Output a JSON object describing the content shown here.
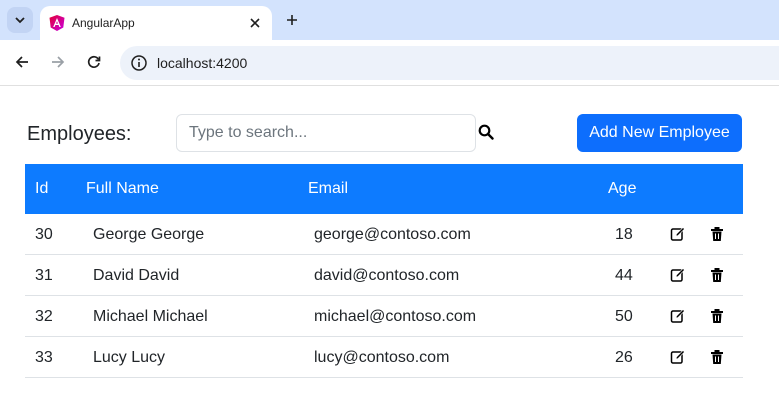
{
  "browser": {
    "tab_title": "AngularApp",
    "url": "localhost:4200"
  },
  "page": {
    "title": "Employees:",
    "search_placeholder": "Type to search...",
    "add_button_label": "Add New Employee"
  },
  "table": {
    "headers": {
      "id": "Id",
      "full_name": "Full Name",
      "email": "Email",
      "age": "Age"
    },
    "rows": [
      {
        "id": "30",
        "full_name": "George George",
        "email": "george@contoso.com",
        "age": "18"
      },
      {
        "id": "31",
        "full_name": "David David",
        "email": "david@contoso.com",
        "age": "44"
      },
      {
        "id": "32",
        "full_name": "Michael Michael",
        "email": "michael@contoso.com",
        "age": "50"
      },
      {
        "id": "33",
        "full_name": "Lucy Lucy",
        "email": "lucy@contoso.com",
        "age": "26"
      }
    ]
  },
  "colors": {
    "accent": "#0d6efd",
    "table_header": "#0d7bff",
    "tabstrip": "#d3e3fd"
  },
  "icons": {
    "row_actions": [
      "edit-icon",
      "trash-icon"
    ]
  }
}
